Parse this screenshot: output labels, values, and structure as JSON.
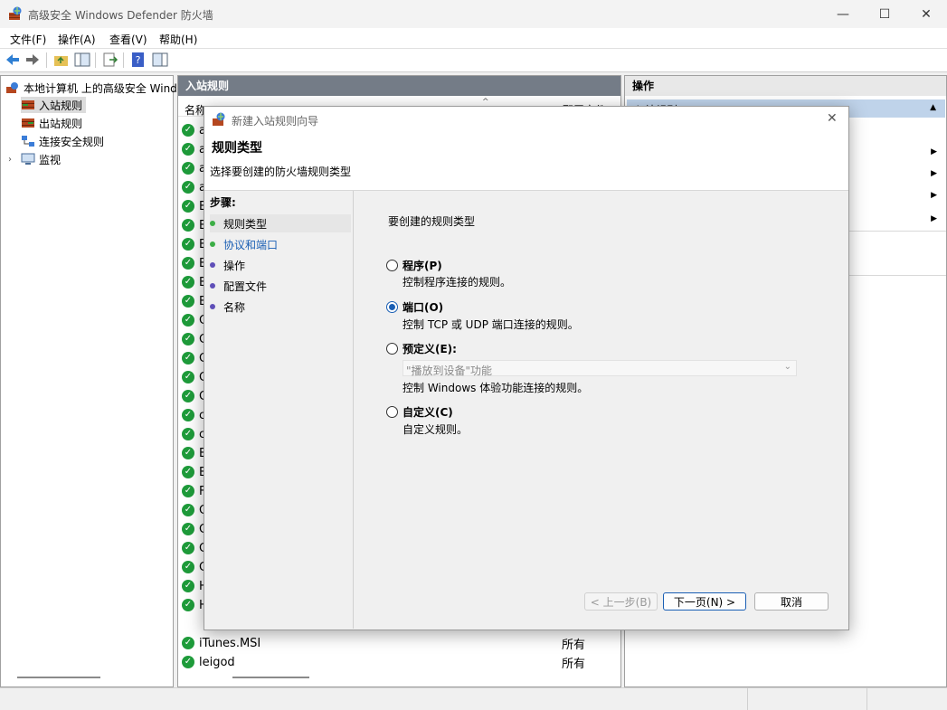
{
  "window": {
    "title": "高级安全 Windows Defender 防火墙",
    "controls": {
      "minimize": "—",
      "maximize": "☐",
      "close": "✕"
    }
  },
  "menu": [
    "文件(F)",
    "操作(A)",
    "查看(V)",
    "帮助(H)"
  ],
  "tree": {
    "root": "本地计算机 上的高级安全 Windows",
    "items": [
      "入站规则",
      "出站规则",
      "连接安全规则",
      "监视"
    ]
  },
  "middle": {
    "header": "入站规则",
    "col_name": "名称",
    "col_profile": "配置文件",
    "partial_names": [
      "a",
      "a",
      "a",
      "a",
      "B",
      "B",
      "B",
      "B",
      "B",
      "B",
      "C",
      "C",
      "C",
      "C",
      "C",
      "c",
      "c",
      "E",
      "E",
      "F",
      "C",
      "C",
      "C",
      "C",
      "H",
      "H"
    ],
    "rows": [
      {
        "name": "iTunes.MSI",
        "profile": "所有"
      },
      {
        "name": "leigod",
        "profile": "所有"
      }
    ]
  },
  "right": {
    "header": "操作",
    "subheader": "入站规则"
  },
  "dialog": {
    "title": "新建入站规则向导",
    "heading": "规则类型",
    "subheading": "选择要创建的防火墙规则类型",
    "steps_title": "步骤:",
    "steps": [
      {
        "label": "规则类型",
        "state": "current"
      },
      {
        "label": "协议和端口",
        "state": "link"
      },
      {
        "label": "操作",
        "state": "pending"
      },
      {
        "label": "配置文件",
        "state": "pending"
      },
      {
        "label": "名称",
        "state": "pending"
      }
    ],
    "question": "要创建的规则类型",
    "options": [
      {
        "label": "程序(P)",
        "desc": "控制程序连接的规则。",
        "selected": false
      },
      {
        "label": "端口(O)",
        "desc": "控制 TCP 或 UDP 端口连接的规则。",
        "selected": true
      },
      {
        "label": "预定义(E):",
        "desc": "控制 Windows 体验功能连接的规则。",
        "selected": false,
        "dropdown": "\"播放到设备\"功能"
      },
      {
        "label": "自定义(C)",
        "desc": "自定义规则。",
        "selected": false
      }
    ],
    "buttons": {
      "back": "< 上一步(B)",
      "next": "下一页(N) >",
      "cancel": "取消"
    }
  },
  "colors": {
    "accent": "#1a5fb4",
    "header_bg": "#747c87",
    "check": "#1e9b3a"
  }
}
